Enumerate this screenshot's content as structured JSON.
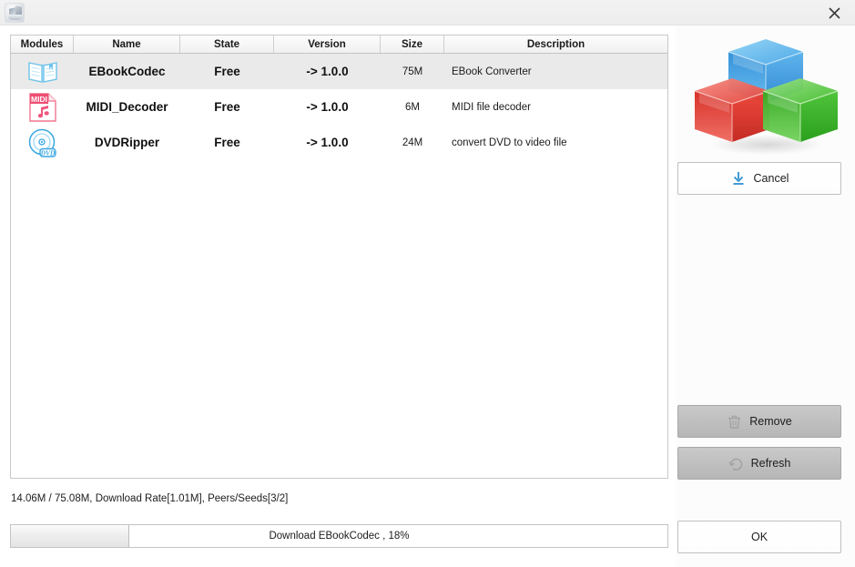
{
  "window": {
    "app_icon": "app-modules-icon",
    "close_icon": "close-icon"
  },
  "table": {
    "columns": [
      {
        "key": "modules",
        "label": "Modules"
      },
      {
        "key": "name",
        "label": "Name"
      },
      {
        "key": "state",
        "label": "State"
      },
      {
        "key": "version",
        "label": "Version"
      },
      {
        "key": "size",
        "label": "Size"
      },
      {
        "key": "description",
        "label": "Description"
      }
    ],
    "rows": [
      {
        "icon": "book-icon",
        "name": "EBookCodec",
        "state": "Free",
        "version": "-> 1.0.0",
        "size": "75M",
        "description": "EBook Converter",
        "selected": true
      },
      {
        "icon": "midi-file-icon",
        "name": "MIDI_Decoder",
        "state": "Free",
        "version": "-> 1.0.0",
        "size": "6M",
        "description": "MIDI file decoder",
        "selected": false
      },
      {
        "icon": "dvd-disc-icon",
        "name": "DVDRipper",
        "state": "Free",
        "version": "-> 1.0.0",
        "size": "24M",
        "description": "convert DVD to video file",
        "selected": false
      }
    ]
  },
  "status": {
    "text": "14.06M / 75.08M, Download Rate[1.01M], Peers/Seeds[3/2]",
    "downloaded": "14.06M",
    "total": "75.08M",
    "download_rate": "1.01M",
    "peers": "3",
    "seeds": "2"
  },
  "progress": {
    "label": "Download EBookCodec , 18%",
    "percent": 18,
    "percent_label": "18%",
    "task": "Download EBookCodec"
  },
  "sidebar": {
    "logo_icon": "three-cubes-logo",
    "logo_colors": {
      "blue": "#2f9fe0",
      "red": "#e02b23",
      "green": "#2fb81f"
    },
    "buttons": [
      {
        "id": "cancel",
        "label": "Cancel",
        "icon": "download-arrow-icon",
        "disabled": false
      },
      {
        "id": "remove",
        "label": "Remove",
        "icon": "trash-icon",
        "disabled": true
      },
      {
        "id": "refresh",
        "label": "Refresh",
        "icon": "refresh-icon",
        "disabled": true
      },
      {
        "id": "ok",
        "label": "OK",
        "icon": "",
        "disabled": false
      }
    ]
  },
  "colors": {
    "accent_blue": "#2f8fd0",
    "selected_row": "#eaeaea",
    "titlebar": "#efefef",
    "panel_bg": "#fcfcfc"
  }
}
